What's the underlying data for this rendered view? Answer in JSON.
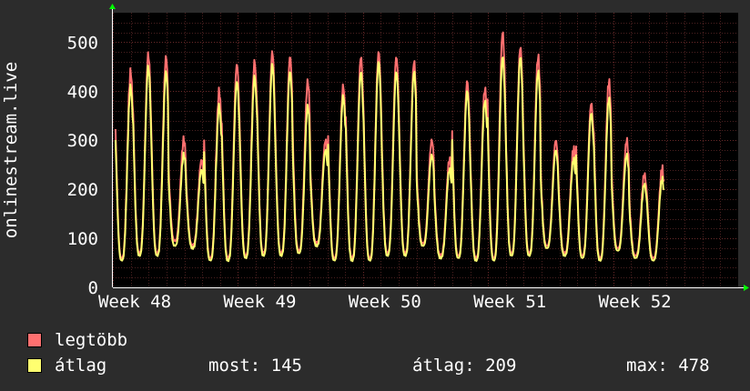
{
  "colors": {
    "background": "#2c2c2c",
    "plot_background": "#000000",
    "grid": "#4a2020",
    "axis": "#ffffff",
    "max_series": "#ff7070",
    "avg_series": "#ffff70",
    "arrow": "#00ff00"
  },
  "chart_data": {
    "type": "area",
    "ylabel": "onlinestream.live",
    "ylim": [
      0,
      560
    ],
    "yticks": [
      "0",
      "100",
      "200",
      "300",
      "400",
      "500"
    ],
    "ytick_values": [
      0,
      100,
      200,
      300,
      400,
      500
    ],
    "xticks": [
      "Week 48",
      "Week 49",
      "Week 50",
      "Week 51",
      "Week 52"
    ],
    "x_days_span": 35,
    "grid": true,
    "series": [
      {
        "name": "legtöbb",
        "color": "#ff7070",
        "daily_peak": [
          440,
          475,
          470,
          300,
          260,
          400,
          455,
          460,
          480,
          470,
          420,
          300,
          410,
          470,
          480,
          470,
          460,
          300,
          260,
          420,
          405,
          520,
          490,
          470,
          300,
          280,
          375,
          420,
          300,
          230,
          240
        ],
        "daily_trough": [
          60,
          70,
          70,
          95,
          85,
          60,
          60,
          65,
          70,
          70,
          75,
          90,
          60,
          60,
          60,
          70,
          70,
          90,
          65,
          65,
          60,
          60,
          70,
          70,
          85,
          70,
          65,
          60,
          80,
          65,
          60
        ]
      },
      {
        "name": "átlag",
        "color": "#ffff70",
        "daily_peak": [
          410,
          450,
          440,
          270,
          240,
          370,
          420,
          430,
          455,
          440,
          370,
          280,
          390,
          440,
          460,
          440,
          440,
          270,
          240,
          400,
          380,
          470,
          470,
          440,
          280,
          260,
          355,
          385,
          270,
          210,
          220
        ],
        "daily_trough": [
          55,
          65,
          65,
          85,
          80,
          55,
          55,
          60,
          65,
          65,
          70,
          85,
          55,
          55,
          55,
          65,
          65,
          85,
          60,
          60,
          55,
          55,
          65,
          65,
          80,
          65,
          60,
          55,
          75,
          60,
          55
        ]
      }
    ]
  },
  "legend": {
    "max_label": "legtöbb",
    "avg_label": "átlag"
  },
  "stats": {
    "now": "most: 145",
    "avg": "átlag: 209",
    "max": "max: 478"
  }
}
